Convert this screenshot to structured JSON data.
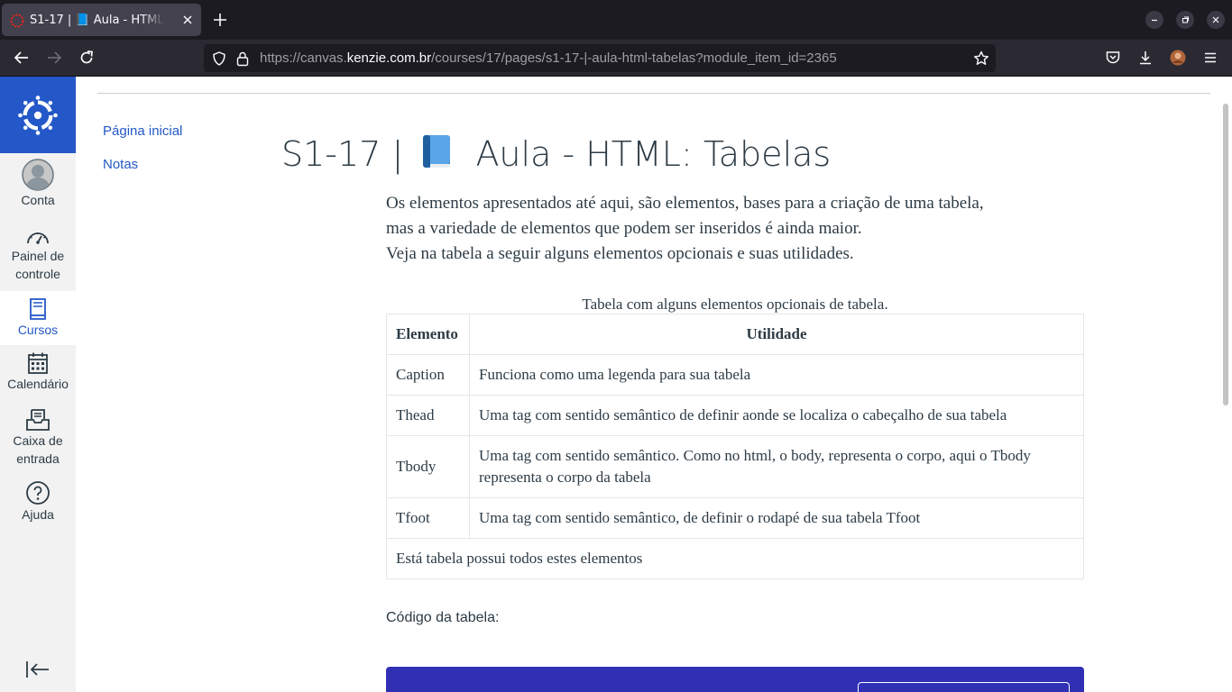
{
  "browser": {
    "tab_title": "S1-17 | 📘 Aula - HTML: Tabelas",
    "url_prefix": "https://canvas.",
    "url_domain": "kenzie.com.br",
    "url_path": "/courses/17/pages/s1-17-|-aula-html-tabelas?module_item_id=2365"
  },
  "global_nav": {
    "items": [
      {
        "label": "Conta",
        "icon": "account-avatar-icon"
      },
      {
        "label": "Painel de",
        "label2": "controle",
        "icon": "dashboard-icon"
      },
      {
        "label": "Cursos",
        "icon": "courses-icon",
        "active": true
      },
      {
        "label": "Calendário",
        "icon": "calendar-icon"
      },
      {
        "label": "Caixa de",
        "label2": "entrada",
        "icon": "inbox-icon"
      },
      {
        "label": "Ajuda",
        "icon": "help-icon"
      }
    ]
  },
  "course_nav": {
    "items": [
      "Página inicial",
      "Notas"
    ]
  },
  "page": {
    "title_prefix": "S1-17 |",
    "title_suffix": "Aula - HTML: Tabelas",
    "intro_lines": [
      "Os elementos apresentados até aqui, são elementos, bases para a criação de uma tabela,",
      "mas a variedade de elementos que podem ser inseridos é ainda maior.",
      "Veja na tabela a seguir alguns elementos opcionais e suas utilidades."
    ],
    "table": {
      "caption": "Tabela com alguns elementos opcionais de tabela.",
      "headers": [
        "Elemento",
        "Utilidade"
      ],
      "rows": [
        [
          "Caption",
          "Funciona como uma legenda para sua tabela"
        ],
        [
          "Thead",
          "Uma tag com sentido semântico de definir aonde se localiza o cabeçalho de sua tabela"
        ],
        [
          "Tbody",
          "Uma tag com sentido semântico. Como no html, o body, representa o corpo, aqui o Tbody representa o corpo da tabela"
        ],
        [
          "Tfoot",
          "Uma tag com sentido semântico, de definir o rodapé de sua tabela Tfoot"
        ]
      ],
      "footer": "Está tabela possui todos estes elementos"
    },
    "code_label": "Código da tabela:"
  },
  "colors": {
    "brand": "#2458c8",
    "code_block": "#3030b4",
    "text": "#2d3b45"
  }
}
